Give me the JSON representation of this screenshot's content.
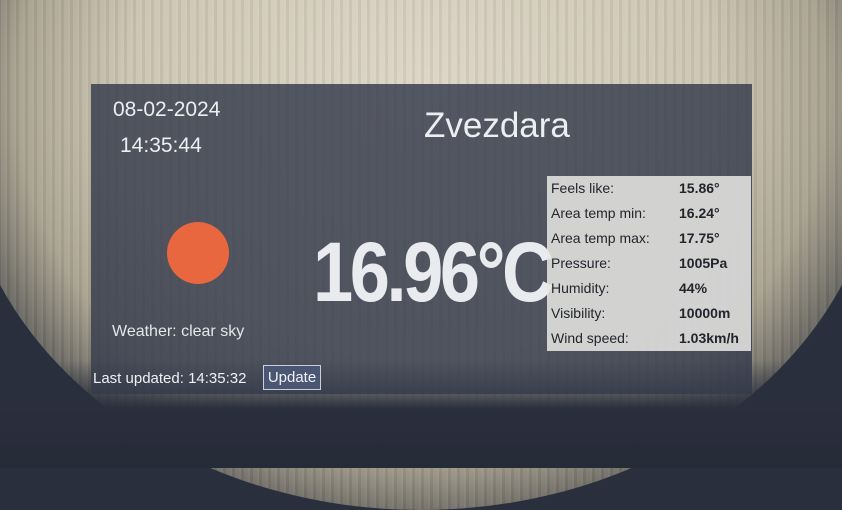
{
  "header": {
    "date": "08-02-2024",
    "time": "14:35:44",
    "city": "Zvezdara"
  },
  "current": {
    "temperature": "16.96°C",
    "weather_label": "Weather: clear sky",
    "icon": "sun-icon",
    "icon_color": "#e8673f"
  },
  "footer": {
    "last_updated": "Last updated: 14:35:32",
    "update_label": "Update"
  },
  "stats": [
    {
      "label": "Feels like:",
      "value": "15.86°"
    },
    {
      "label": "Area temp min:",
      "value": "16.24°"
    },
    {
      "label": "Area temp max:",
      "value": "17.75°"
    },
    {
      "label": "Pressure:",
      "value": "1005Pa"
    },
    {
      "label": "Humidity:",
      "value": "44%"
    },
    {
      "label": "Visibility:",
      "value": "10000m"
    },
    {
      "label": "Wind speed:",
      "value": "1.03km/h"
    }
  ]
}
